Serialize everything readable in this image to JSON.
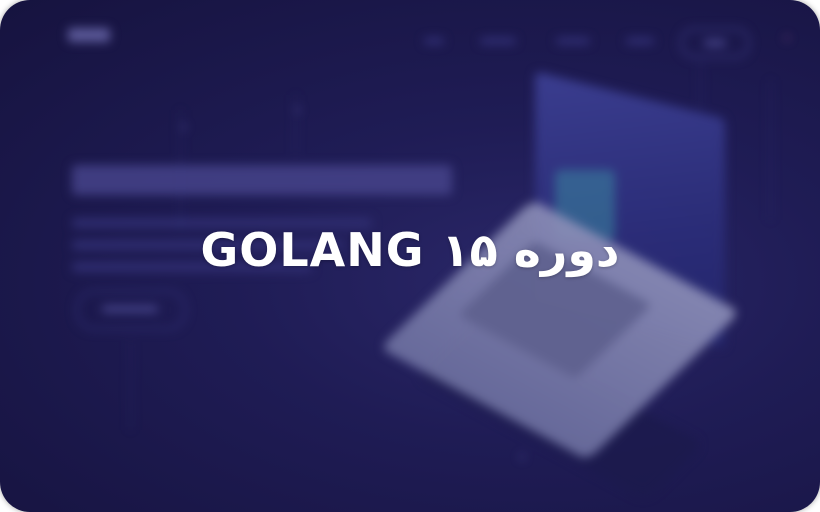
{
  "banner": {
    "title": "GOLANG ۱۵ دوره"
  },
  "colors": {
    "background": "#1f1c55",
    "title_text": "#ffffff"
  }
}
